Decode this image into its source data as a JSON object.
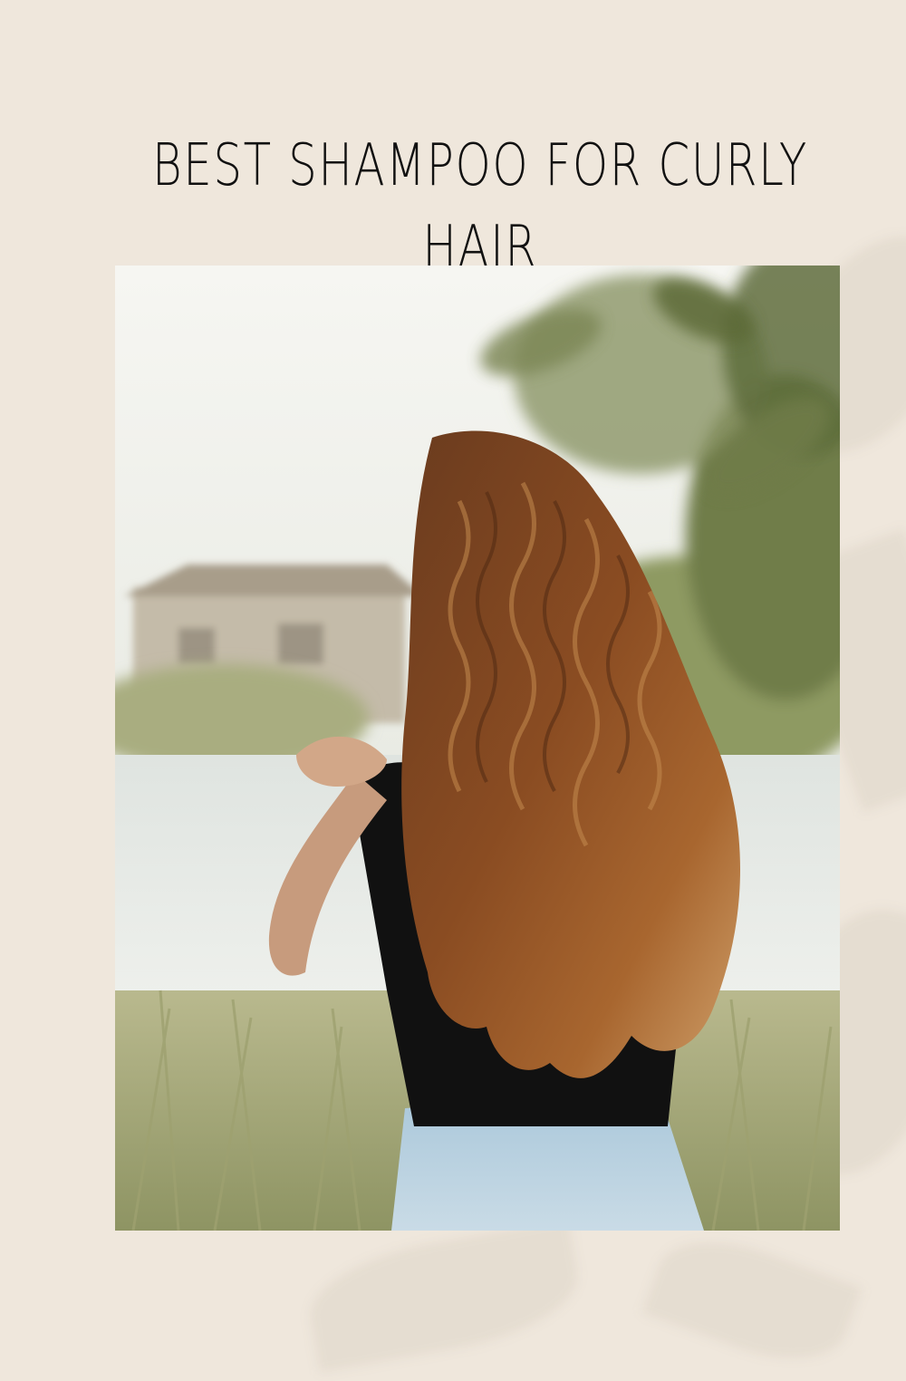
{
  "pin": {
    "title": "BEST SHAMPOO FOR CURLY HAIR",
    "photo": {
      "subject": "woman-with-long-curly-hair-back-view",
      "icon": "photo"
    },
    "colors": {
      "background": "#efe7dc",
      "text": "#111111"
    }
  }
}
